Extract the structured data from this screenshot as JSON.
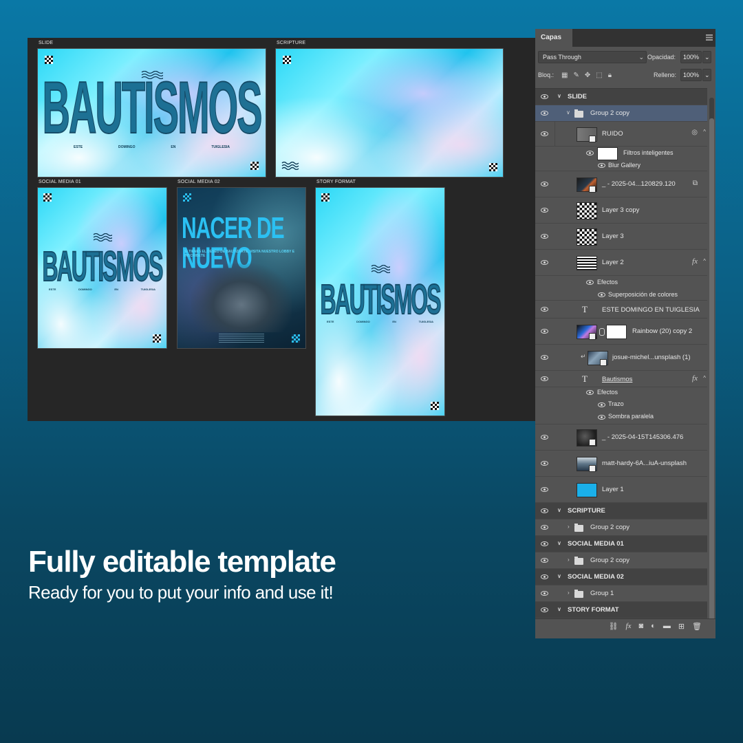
{
  "canvas": {
    "artboards": {
      "slide": {
        "label": "SLIDE",
        "title": "BAUTISMOS",
        "row": [
          "ESTE",
          "DOMINGO",
          "EN",
          "TUIGLESIA"
        ]
      },
      "scripture": {
        "label": "SCRIPTURE"
      },
      "social1": {
        "label": "SOCIAL MEDIA 01",
        "title": "BAUTISMOS",
        "row": [
          "ESTE",
          "DOMINGO",
          "EN",
          "TUIGLESIA"
        ]
      },
      "social2": {
        "label": "SOCIAL MEDIA 02",
        "title": "NACER DE NUEVO",
        "subtitle": "SI TIENES EL DESEO DE BAUTIZARTE, VISITA NUESTRO LOBBY E INSCRIBETE"
      },
      "story": {
        "label": "STORY FORMAT",
        "title": "BAUTISMOS",
        "row": [
          "ESTE",
          "DOMINGO",
          "EN",
          "TUIGLESIA"
        ]
      }
    }
  },
  "layers_panel": {
    "tab": "Capas",
    "blend_mode": "Pass Through",
    "opacity_label": "Opacidad:",
    "opacity": "100%",
    "lock_label": "Bloq.:",
    "fill_label": "Relleno:",
    "fill": "100%",
    "rows": {
      "slide": "SLIDE",
      "group2copy": "Group 2 copy",
      "ruido": "RUIDO",
      "filtros": "Filtros inteligentes",
      "blur": "Blur Gallery",
      "img1": "_ - 2025-04...120829.120",
      "layer3copy": "Layer 3 copy",
      "layer3": "Layer 3",
      "layer2": "Layer 2",
      "efectos1": "Efectos",
      "superpos": "Superposición de colores",
      "este": "ESTE DOMINGO EN TUIGLESIA",
      "rainbow": "Rainbow (20) copy 2",
      "josue": "josue-michel...unsplash (1)",
      "bautismos": "Bautismos",
      "efectos2": "Efectos",
      "trazo": "Trazo",
      "sombra": "Sombra paralela",
      "img2": "_ - 2025-04-15T145306.476",
      "matt": "matt-hardy-6A...iuA-unsplash",
      "layer1": "Layer 1",
      "scripture": "SCRIPTURE",
      "scr_group": "Group 2 copy",
      "sm01": "SOCIAL MEDIA 01",
      "sm01_group": "Group 2 copy",
      "sm02": "SOCIAL MEDIA 02",
      "sm02_group": "Group 1",
      "story": "STORY FORMAT"
    },
    "fx_symbol": "fx",
    "text_symbol": "T"
  },
  "promo": {
    "headline": "Fully editable template",
    "subline": "Ready for you to put your info and use it!"
  },
  "colors": {
    "accent_cyan": "#2cd8f6",
    "selected_row": "#4f5f78",
    "panel_bg": "#535353"
  }
}
